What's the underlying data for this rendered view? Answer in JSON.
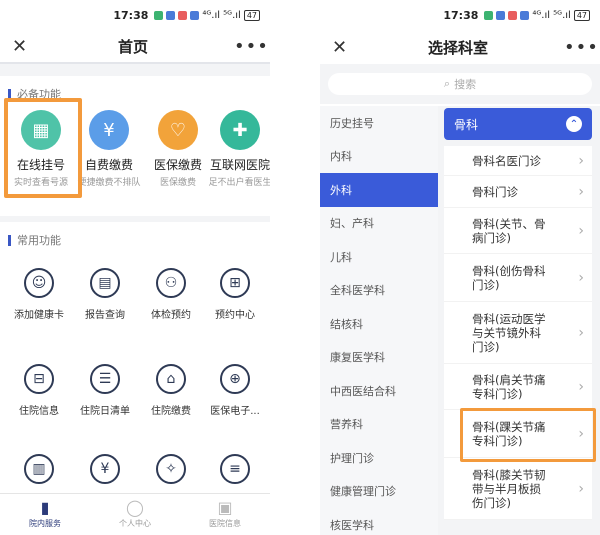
{
  "left": {
    "status": {
      "time": "17:38",
      "signal": "⁴ᴳ.ıl ⁵ᴳ.ıl",
      "battery": "47"
    },
    "title": "首页",
    "close": "✕",
    "more": "•••",
    "must_section": "必备功能",
    "must_items": [
      {
        "name": "在线挂号",
        "sub": "实时查看号源",
        "color": "#4fc3a8",
        "icon": "calendar-icon"
      },
      {
        "name": "自费缴费",
        "sub": "便捷缴费不排队",
        "color": "#5b9de8",
        "icon": "coin-icon"
      },
      {
        "name": "医保缴费",
        "sub": "医保缴费",
        "color": "#f2a33a",
        "icon": "pulse-card-icon"
      },
      {
        "name": "互联网医院",
        "sub": "足不出户看医生",
        "color": "#35b89a",
        "icon": "medkit-icon"
      }
    ],
    "common_section": "常用功能",
    "common_items": [
      {
        "name": "添加健康卡",
        "icon": "user-icon"
      },
      {
        "name": "报告查询",
        "icon": "report-icon"
      },
      {
        "name": "体检预约",
        "icon": "group-icon"
      },
      {
        "name": "预约中心",
        "icon": "box-plus-icon"
      },
      {
        "name": "住院信息",
        "icon": "bed-icon"
      },
      {
        "name": "住院日清单",
        "icon": "list-icon"
      },
      {
        "name": "住院缴费",
        "icon": "home-icon"
      },
      {
        "name": "医保电子...",
        "icon": "doc-plus-icon"
      },
      {
        "name": "",
        "icon": "doc-icon"
      },
      {
        "name": "",
        "icon": "yuan-icon"
      },
      {
        "name": "",
        "icon": "compass-icon"
      },
      {
        "name": "",
        "icon": "note-icon"
      }
    ],
    "tabs": [
      {
        "label": "院内服务",
        "icon": "hospital-icon",
        "active": true
      },
      {
        "label": "个人中心",
        "icon": "person-icon",
        "active": false
      },
      {
        "label": "医院信息",
        "icon": "building-icon",
        "active": false
      }
    ]
  },
  "right": {
    "status": {
      "time": "17:38",
      "signal": "⁴ᴳ.ıl ⁵ᴳ.ıl",
      "battery": "47"
    },
    "title": "选择科室",
    "close": "✕",
    "more": "•••",
    "search_placeholder": "搜索",
    "departments": [
      "历史挂号",
      "内科",
      "外科",
      "妇、产科",
      "儿科",
      "全科医学科",
      "结核科",
      "康复医学科",
      "中西医结合科",
      "营养科",
      "护理门诊",
      "健康管理门诊",
      "核医学科"
    ],
    "active_department": "外科",
    "category": "骨科",
    "clinics": [
      "骨科名医门诊",
      "骨科门诊",
      "骨科(关节、骨病门诊)",
      "骨科(创伤骨科门诊)",
      "骨科(运动医学与关节镜外科门诊)",
      "骨科(肩关节痛专科门诊)",
      "骨科(踝关节痛专科门诊)",
      "骨科(膝关节韧带与半月板损伤门诊)"
    ]
  },
  "colors": {
    "accent": "#3a5bd9",
    "highlight": "#f39a3c",
    "nav_dark": "#2c3b7a"
  }
}
